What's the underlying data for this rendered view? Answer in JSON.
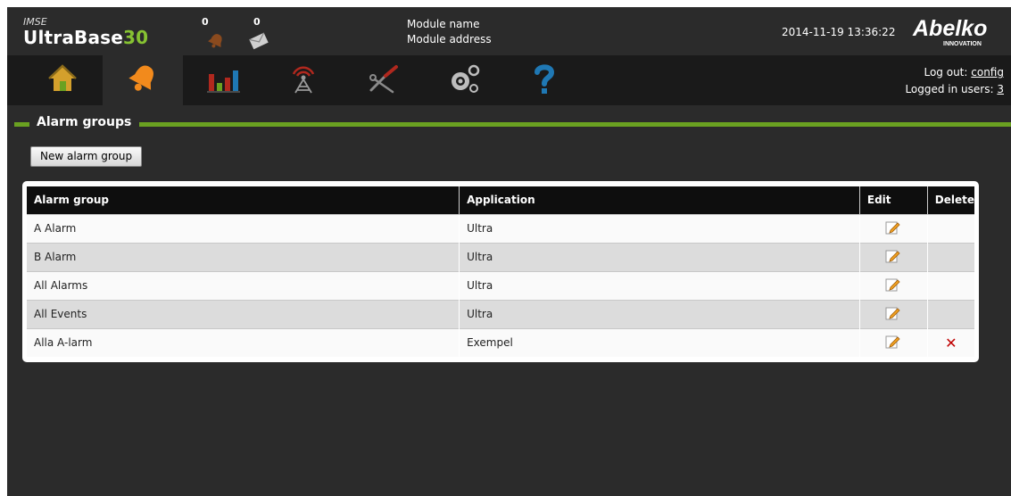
{
  "header": {
    "brand_small": "IMSE",
    "brand_main": "UltraBase",
    "brand_num": "30",
    "alarm_count": "0",
    "message_count": "0",
    "module_name": "Module name",
    "module_address": "Module address",
    "datetime": "2014-11-19 13:36:22",
    "logo_text": "Abelko",
    "logo_sub": "INNOVATION"
  },
  "nav": {
    "items": [
      {
        "icon": "home-icon"
      },
      {
        "icon": "bell-icon"
      },
      {
        "icon": "bar-chart-icon"
      },
      {
        "icon": "antenna-icon"
      },
      {
        "icon": "tools-icon"
      },
      {
        "icon": "gears-icon"
      },
      {
        "icon": "help-icon"
      }
    ],
    "logout_label": "Log out:",
    "logout_user": "config",
    "logged_in_label": "Logged in users:",
    "logged_in_count": "3"
  },
  "section": {
    "title": "Alarm groups",
    "new_button": "New alarm group"
  },
  "table": {
    "headers": [
      "Alarm group",
      "Application",
      "Edit",
      "Delete"
    ],
    "rows": [
      {
        "group": "A Alarm",
        "app": "Ultra"
      },
      {
        "group": "B Alarm",
        "app": "Ultra"
      },
      {
        "group": "All Alarms",
        "app": "Ultra"
      },
      {
        "group": "All Events",
        "app": "Ultra"
      },
      {
        "group": "Alla A-larm",
        "app": "Exempel"
      }
    ],
    "delete_glyph": "✕"
  },
  "colors": {
    "accent_green": "#6aa121",
    "header_bg": "#2b2b2b",
    "nav_bg": "#1a1a1a",
    "alarm_orange": "#f28a1c",
    "delete_red": "#c00000"
  }
}
